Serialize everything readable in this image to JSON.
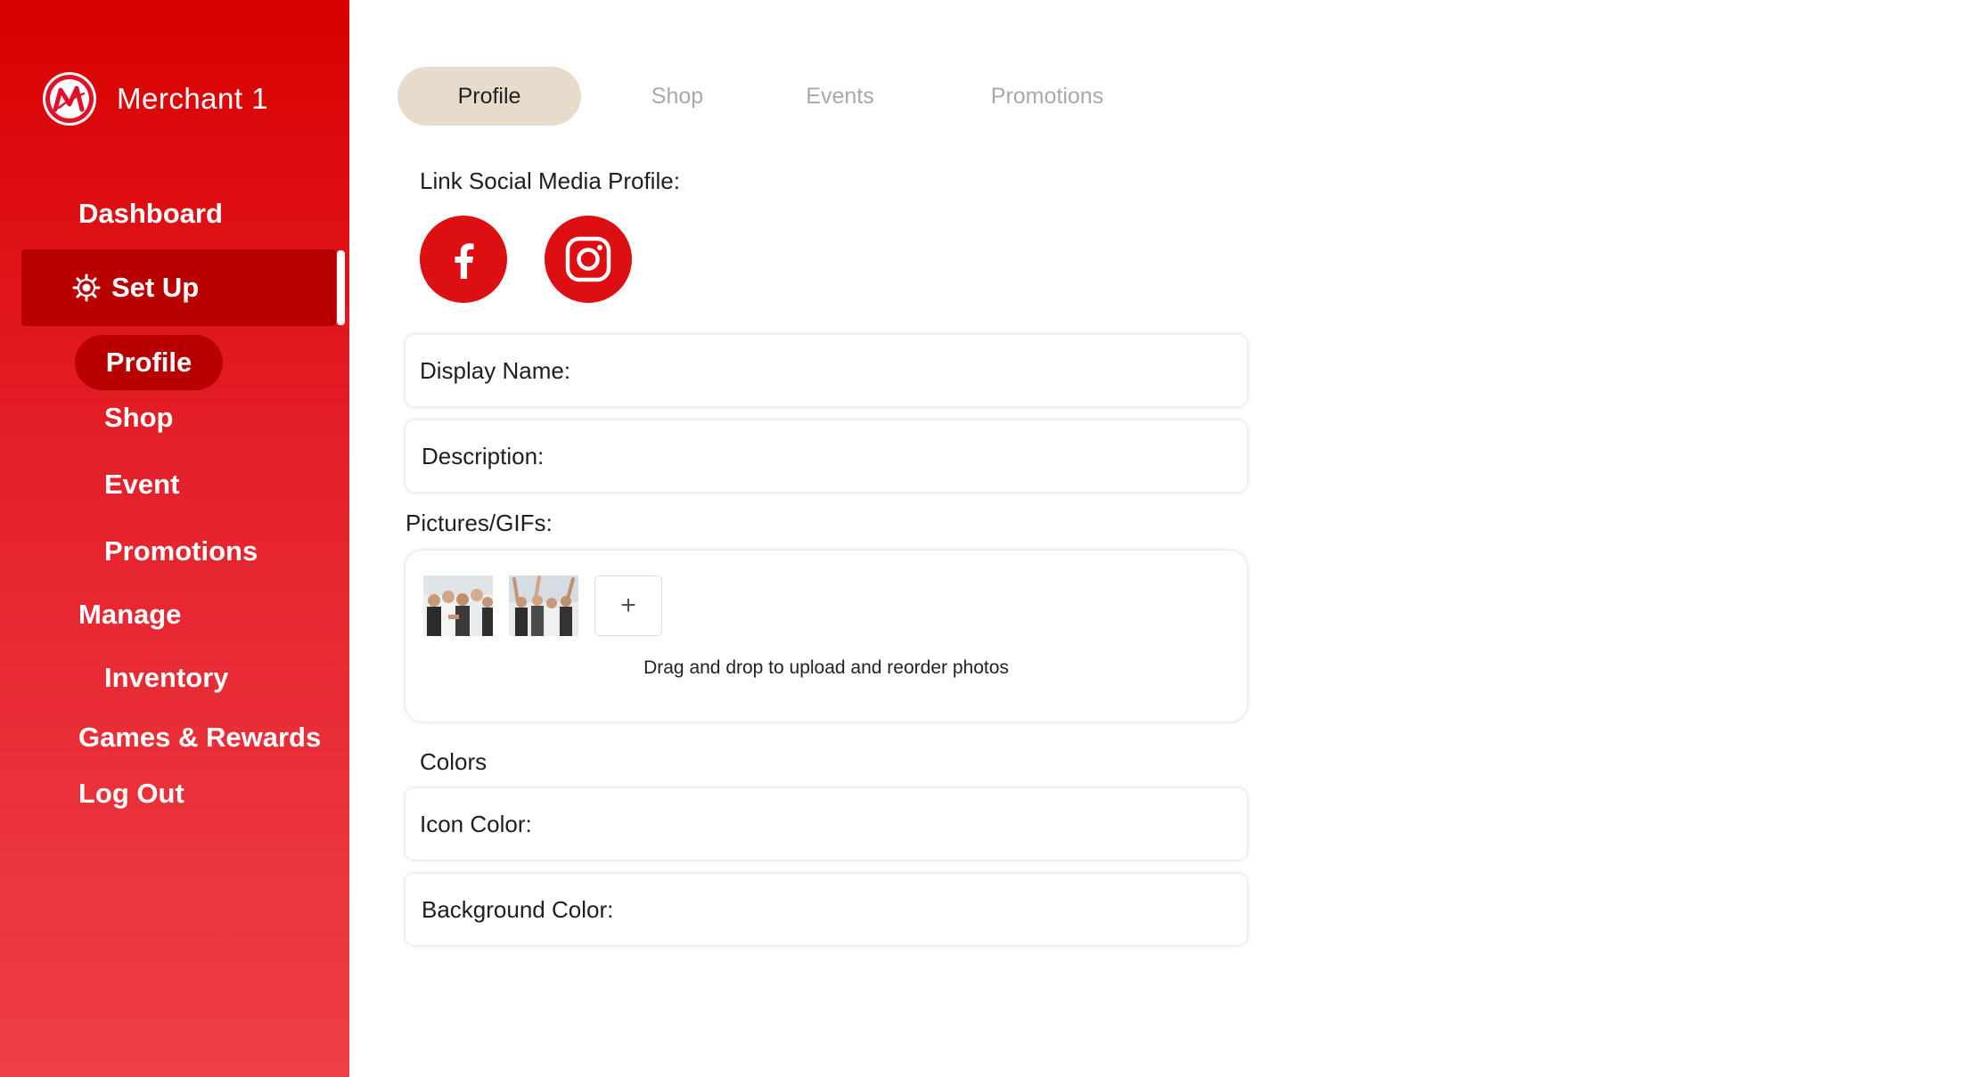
{
  "brand": {
    "name": "Merchant 1",
    "logo_icon": "merchant-m-logo"
  },
  "sidebar": {
    "dashboard": "Dashboard",
    "setup": {
      "label": "Set Up",
      "icon": "gear-icon"
    },
    "setup_items": [
      "Profile",
      "Shop",
      "Event",
      "Promotions"
    ],
    "active_item": "Profile",
    "manage": "Manage",
    "manage_items": [
      "Inventory"
    ],
    "games": "Games & Rewards",
    "logout": "Log Out"
  },
  "tabs": [
    {
      "label": "Profile",
      "active": true
    },
    {
      "label": "Shop",
      "active": false
    },
    {
      "label": "Events",
      "active": false
    },
    {
      "label": "Promotions",
      "active": false
    }
  ],
  "profile": {
    "social_label": "Link Social Media Profile:",
    "social_links": [
      {
        "name": "Facebook",
        "icon": "facebook-icon"
      },
      {
        "name": "Instagram",
        "icon": "instagram-icon"
      }
    ],
    "display_name_label": "Display Name:",
    "description_label": "Description:",
    "pictures_label": "Pictures/GIFs:",
    "add_symbol": "+",
    "upload_hint": "Drag and drop to upload and reorder photos",
    "colors_heading": "Colors",
    "icon_color_label": "Icon Color:",
    "background_color_label": "Background Color:"
  },
  "colors": {
    "brand_red": "#de0f12",
    "sidebar_active": "#b80000",
    "tab_active_bg": "#e7dccb",
    "tab_inactive_text": "#a9a9a9"
  }
}
